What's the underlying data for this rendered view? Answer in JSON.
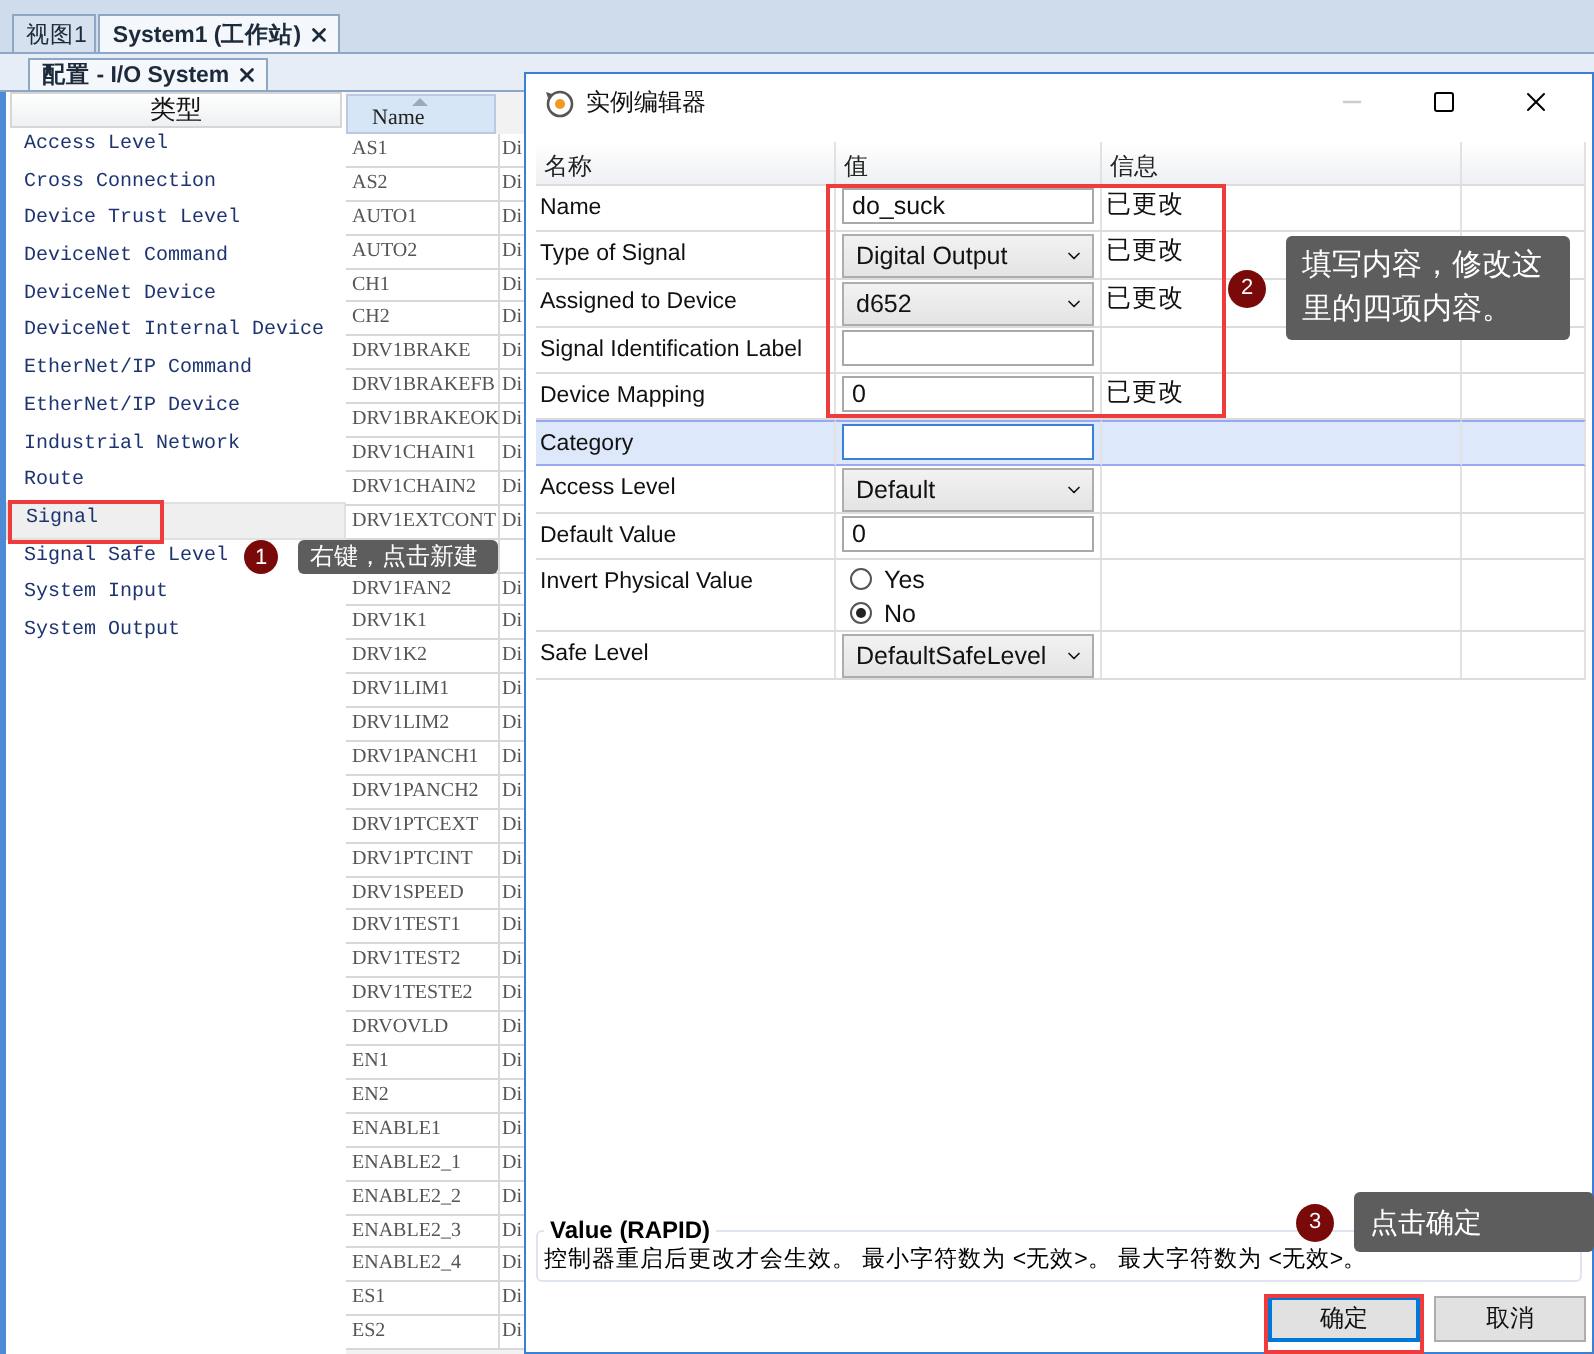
{
  "tabs": [
    {
      "label": "视图1",
      "selected": false,
      "closable": false
    },
    {
      "label": "System1 (工作站)",
      "selected": true,
      "closable": true
    }
  ],
  "subtabs": [
    {
      "label": "配置 - I/O System",
      "selected": true,
      "closable": true
    }
  ],
  "type_panel": {
    "header": "类型",
    "items": [
      {
        "label": "Access Level",
        "selected": false
      },
      {
        "label": "Cross Connection",
        "selected": false
      },
      {
        "label": "Device Trust Level",
        "selected": false
      },
      {
        "label": "DeviceNet Command",
        "selected": false
      },
      {
        "label": "DeviceNet Device",
        "selected": false
      },
      {
        "label": "DeviceNet Internal Device",
        "selected": false
      },
      {
        "label": "EtherNet/IP Command",
        "selected": false
      },
      {
        "label": "EtherNet/IP Device",
        "selected": false
      },
      {
        "label": "Industrial Network",
        "selected": false
      },
      {
        "label": "Route",
        "selected": false
      },
      {
        "label": "Signal",
        "selected": true
      },
      {
        "label": "Signal Safe Level",
        "selected": false
      },
      {
        "label": "System Input",
        "selected": false
      },
      {
        "label": "System Output",
        "selected": false
      }
    ]
  },
  "signal_table": {
    "columns": [
      "Name"
    ],
    "rows": [
      {
        "name": "AS1",
        "column_2": "Di"
      },
      {
        "name": "AS2",
        "column_2": "Di"
      },
      {
        "name": "AUTO1",
        "column_2": "Di"
      },
      {
        "name": "AUTO2",
        "column_2": "Di"
      },
      {
        "name": "CH1",
        "column_2": "Di"
      },
      {
        "name": "CH2",
        "column_2": "Di"
      },
      {
        "name": "DRV1BRAKE",
        "column_2": "Di"
      },
      {
        "name": "DRV1BRAKEFB",
        "column_2": "Di"
      },
      {
        "name": "DRV1BRAKEOK",
        "column_2": "Di"
      },
      {
        "name": "DRV1CHAIN1",
        "column_2": "Di"
      },
      {
        "name": "DRV1CHAIN2",
        "column_2": "Di"
      },
      {
        "name": "DRV1EXTCONT",
        "column_2": "Di"
      },
      {},
      {
        "name": "DRV1FAN2",
        "column_2": "Di"
      },
      {
        "name": "DRV1K1",
        "column_2": "Di"
      },
      {
        "name": "DRV1K2",
        "column_2": "Di"
      },
      {
        "name": "DRV1LIM1",
        "column_2": "Di"
      },
      {
        "name": "DRV1LIM2",
        "column_2": "Di"
      },
      {
        "name": "DRV1PANCH1",
        "column_2": "Di"
      },
      {
        "name": "DRV1PANCH2",
        "column_2": "Di"
      },
      {
        "name": "DRV1PTCEXT",
        "column_2": "Di"
      },
      {
        "name": "DRV1PTCINT",
        "column_2": "Di"
      },
      {
        "name": "DRV1SPEED",
        "column_2": "Di"
      },
      {
        "name": "DRV1TEST1",
        "column_2": "Di"
      },
      {
        "name": "DRV1TEST2",
        "column_2": "Di"
      },
      {
        "name": "DRV1TESTE2",
        "column_2": "Di"
      },
      {
        "name": "DRVOVLD",
        "column_2": "Di"
      },
      {
        "name": "EN1",
        "column_2": "Di"
      },
      {
        "name": "EN2",
        "column_2": "Di"
      },
      {
        "name": "ENABLE1",
        "column_2": "Di"
      },
      {
        "name": "ENABLE2_1",
        "column_2": "Di"
      },
      {
        "name": "ENABLE2_2",
        "column_2": "Di"
      },
      {
        "name": "ENABLE2_3",
        "column_2": "Di"
      },
      {
        "name": "ENABLE2_4",
        "column_2": "Di"
      },
      {
        "name": "ES1",
        "column_2": "Di"
      },
      {
        "name": "ES2",
        "column_2": "Di"
      }
    ]
  },
  "dialog": {
    "title": "实例编辑器",
    "columns": [
      "名称",
      "值",
      "信息"
    ],
    "properties": [
      {
        "kind": "text",
        "name": "Name",
        "value": "do_suck",
        "info": "已更改",
        "selected": false
      },
      {
        "kind": "select",
        "name": "Type of Signal",
        "value": "Digital Output",
        "info": "已更改",
        "selected": false
      },
      {
        "kind": "select",
        "name": "Assigned to Device",
        "value": "d652",
        "info": "已更改",
        "selected": false
      },
      {
        "kind": "text",
        "name": "Signal Identification Label",
        "selected": false
      },
      {
        "kind": "text",
        "name": "Device Mapping",
        "value": "0",
        "info": "已更改",
        "selected": false
      },
      {
        "kind": "text",
        "name": "Category",
        "selected": true
      },
      {
        "kind": "select",
        "name": "Access Level",
        "value": "Default",
        "selected": false
      },
      {
        "kind": "text",
        "name": "Default Value",
        "value": "0",
        "selected": false
      },
      {
        "kind": "radio",
        "name": "Invert Physical Value",
        "options": [
          {
            "label": "Yes",
            "selected": false
          },
          {
            "label": "No",
            "selected": true
          }
        ],
        "selected": false
      },
      {
        "kind": "select",
        "name": "Safe Level",
        "value": "DefaultSafeLevel",
        "selected": false
      }
    ],
    "value_group": {
      "title": "Value (RAPID)",
      "text": "控制器重启后更改才会生效。 最小字符数为 <无效>。 最大字符数为 <无效>。"
    },
    "buttons": [
      {
        "label": "确定",
        "default": true
      },
      {
        "label": "取消",
        "default": false
      }
    ]
  },
  "annotations": [
    {
      "number": "1",
      "text": "右键，点击新建"
    },
    {
      "number": "2",
      "text": "填写内容，修改这里的四项内容。"
    },
    {
      "number": "3",
      "text": "点击确定"
    }
  ]
}
